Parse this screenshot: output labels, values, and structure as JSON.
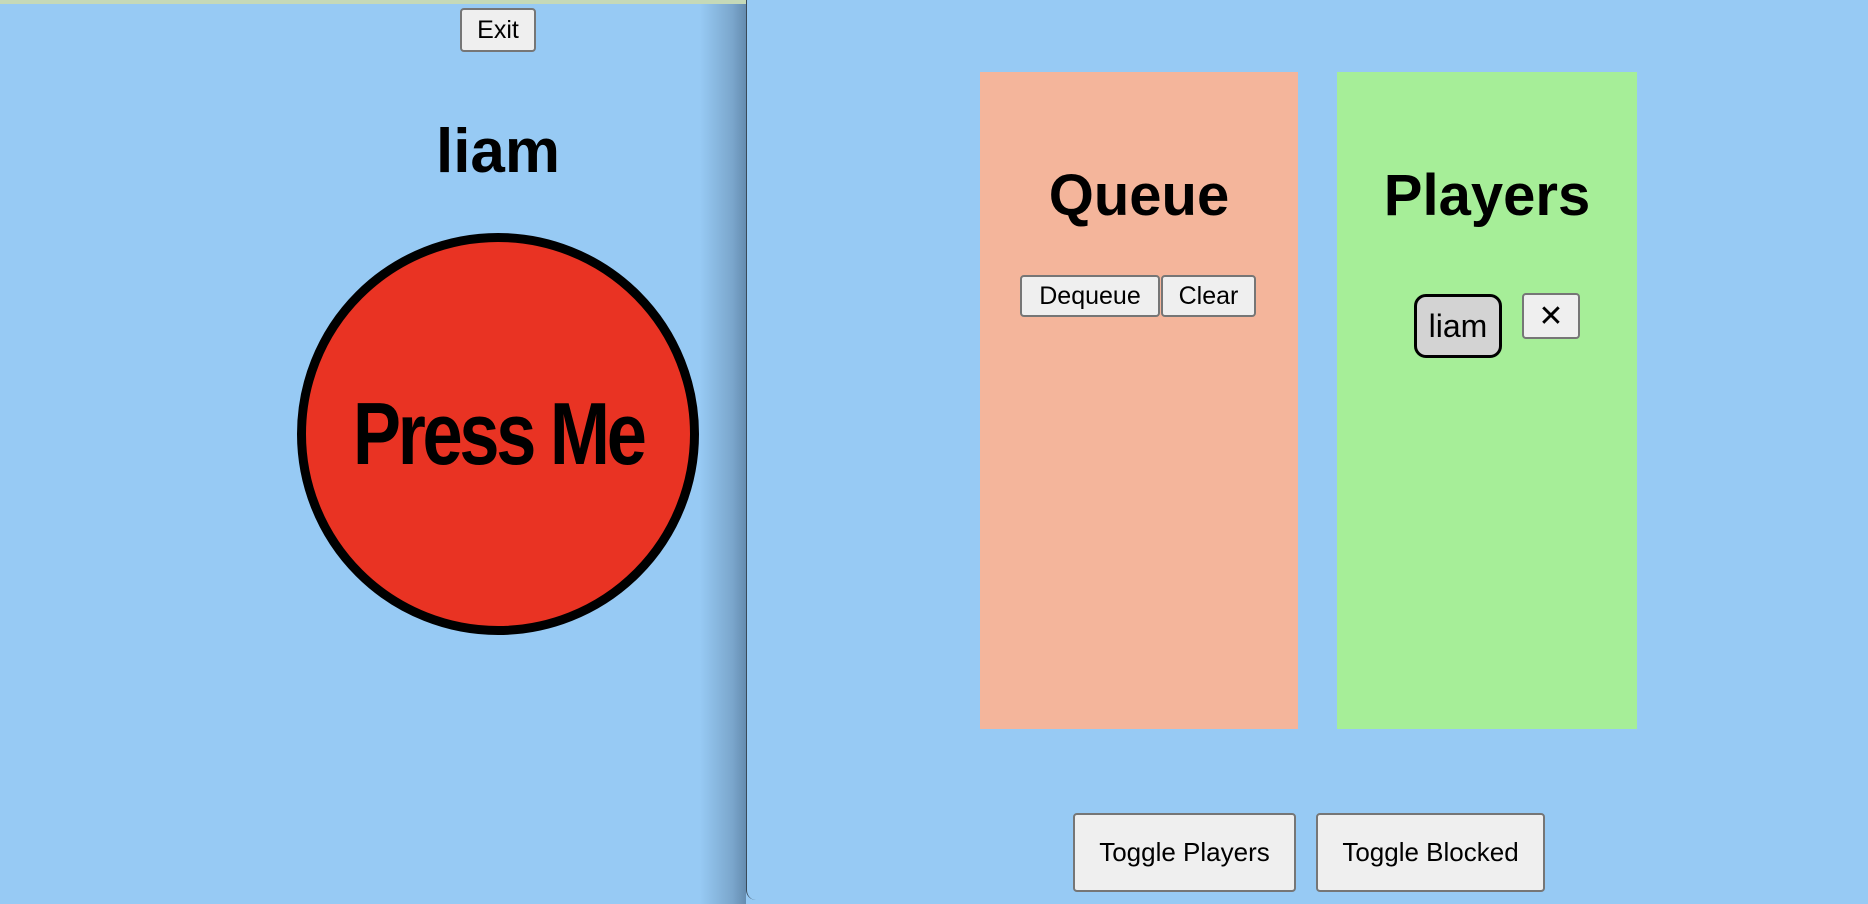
{
  "player_view": {
    "exit_label": "Exit",
    "player_name": "liam",
    "press_me_label": "Press Me"
  },
  "host_view": {
    "queue": {
      "title": "Queue",
      "dequeue_label": "Dequeue",
      "clear_label": "Clear",
      "items": []
    },
    "players": {
      "title": "Players",
      "items": [
        {
          "name": "liam",
          "remove_icon": "close-icon",
          "remove_glyph": "✕"
        }
      ]
    },
    "toggle_players_label": "Toggle Players",
    "toggle_blocked_label": "Toggle Blocked"
  },
  "colors": {
    "background": "#97caf4",
    "press_me": "#e93323",
    "queue_panel": "#f4b59b",
    "players_panel": "#a6ee98",
    "remove_icon": "#e03a3a"
  }
}
